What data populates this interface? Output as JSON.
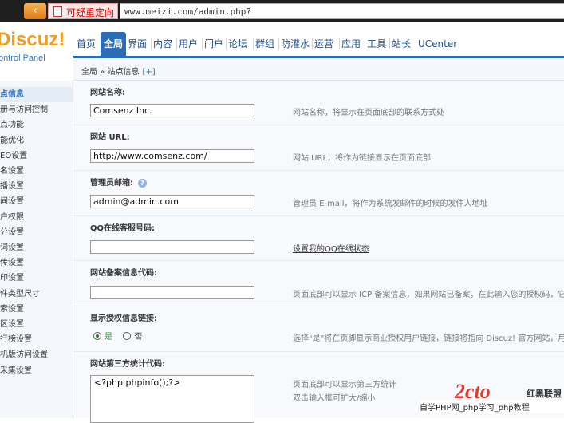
{
  "browser": {
    "back_glyph": "‹",
    "warning_label": "可疑重定向",
    "url": "www.meizi.com/admin.php?"
  },
  "logo": {
    "main": "Discuz!",
    "sub": "ontrol Panel"
  },
  "topnav": {
    "items": [
      "首页",
      "全局",
      "界面",
      "内容",
      "用户",
      "门户",
      "论坛",
      "群组",
      "防灌水",
      "运营",
      "应用",
      "工具",
      "站长",
      "UCenter"
    ]
  },
  "breadcrumb": {
    "text": "全局 » 站点信息",
    "add": "[+]"
  },
  "sidebar": {
    "items": [
      "点信息",
      "册与访问控制",
      "点功能",
      "能优化",
      "EO设置",
      "名设置",
      "播设置",
      "间设置",
      "户权限",
      "分设置",
      "词设置",
      "传设置",
      "印设置",
      "件类型尺寸",
      "索设置",
      "区设置",
      "行榜设置",
      "机版访问设置",
      "采集设置"
    ]
  },
  "form": {
    "site_name": {
      "label": "网站名称:",
      "value": "Comsenz Inc.",
      "desc": "网站名称，将显示在页面底部的联系方式处"
    },
    "site_url": {
      "label": "网站 URL:",
      "value": "http://www.comsenz.com/",
      "desc": "网站 URL，将作为链接显示在页面底部"
    },
    "admin_email": {
      "label": "管理员邮箱:",
      "help": "?",
      "value": "admin@admin.com",
      "desc": "管理员 E-mail，将作为系统发邮件的时候的发件人地址"
    },
    "qq_service": {
      "label": "QQ在线客服号码:",
      "value": "",
      "link": "设置我的QQ在线状态"
    },
    "icp": {
      "label": "网站备案信息代码:",
      "value": "",
      "desc": "页面底部可以显示 ICP 备案信息，如果网站已备案，在此输入您的授权码，它将"
    },
    "license_link": {
      "label": "显示授权信息链接:",
      "yes": "是",
      "no": "否",
      "desc": "选择\"是\"将在页脚显示商业授权用户链接，链接将指向 Discuz! 官方网站，用户"
    },
    "stats_code": {
      "label": "网站第三方统计代码:",
      "value": "<?php  phpinfo();?>",
      "desc1": "页面底部可以显示第三方统计",
      "desc2": "双击输入框可扩大/缩小"
    }
  },
  "watermark": {
    "logo": "2cto",
    "brand": "红黑联盟",
    "text": "自学PHP网_php学习_php教程"
  }
}
